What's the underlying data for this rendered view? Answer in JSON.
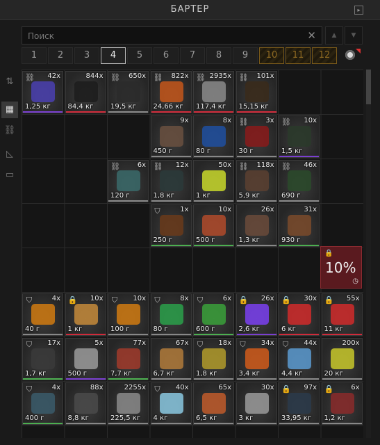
{
  "window": {
    "title": "БАРТЕР"
  },
  "search": {
    "placeholder": "Поиск"
  },
  "pages": [
    "1",
    "2",
    "3",
    "4",
    "5",
    "6",
    "7",
    "8",
    "9",
    "10",
    "11",
    "12"
  ],
  "active_page": "4",
  "locked_percent": "10%",
  "colors": {
    "common": "#888888",
    "uncommon": "#4caf50",
    "rare": "#7a3fd0",
    "epic": "#d02a3a"
  },
  "items": [
    {
      "row": 0,
      "col": 0,
      "qty": "42x",
      "price": "1,25 кг",
      "mark": "link",
      "color": "#4a3fb0",
      "rarity": "#7a3fd0"
    },
    {
      "row": 0,
      "col": 1,
      "qty": "844x",
      "price": "84,4 кг",
      "mark": "",
      "color": "#1c1c1c",
      "rarity": "#d02a3a"
    },
    {
      "row": 0,
      "col": 2,
      "qty": "650x",
      "price": "19,5 кг",
      "mark": "link",
      "color": "#2a2a2a",
      "rarity": "#888888"
    },
    {
      "row": 0,
      "col": 3,
      "qty": "822x",
      "price": "24,66 кг",
      "mark": "link",
      "color": "#c4561a",
      "rarity": "#d02a3a"
    },
    {
      "row": 0,
      "col": 4,
      "qty": "2935x",
      "price": "117,4 кг",
      "mark": "link",
      "color": "#8a8a8a",
      "rarity": "#d02a3a"
    },
    {
      "row": 0,
      "col": 5,
      "qty": "101x",
      "price": "15,15 кг",
      "mark": "link",
      "color": "#3a2a1a",
      "rarity": "#d02a3a"
    },
    {
      "row": 1,
      "col": 3,
      "qty": "9x",
      "price": "450 г",
      "mark": "",
      "color": "#6a5040",
      "rarity": "#888888"
    },
    {
      "row": 1,
      "col": 4,
      "qty": "8x",
      "price": "80 г",
      "mark": "",
      "color": "#1f4fa0",
      "rarity": "#888888"
    },
    {
      "row": 1,
      "col": 5,
      "qty": "3x",
      "price": "30 г",
      "mark": "link",
      "color": "#8a1a1a",
      "rarity": "#888888"
    },
    {
      "row": 1,
      "col": 6,
      "qty": "10x",
      "price": "1,5 кг",
      "mark": "link",
      "color": "#2a3a2a",
      "rarity": "#7a3fd0"
    },
    {
      "row": 2,
      "col": 2,
      "qty": "6x",
      "price": "120 г",
      "mark": "link",
      "color": "#3a6a6a",
      "rarity": "#888888"
    },
    {
      "row": 2,
      "col": 3,
      "qty": "12x",
      "price": "1,8 кг",
      "mark": "link",
      "color": "#2a3a3a",
      "rarity": "#888888"
    },
    {
      "row": 2,
      "col": 4,
      "qty": "50x",
      "price": "1 кг",
      "mark": "",
      "color": "#c8d82a",
      "rarity": "#888888"
    },
    {
      "row": 2,
      "col": 5,
      "qty": "118x",
      "price": "5,9 кг",
      "mark": "link",
      "color": "#5a4030",
      "rarity": "#888888"
    },
    {
      "row": 2,
      "col": 6,
      "qty": "46x",
      "price": "690 г",
      "mark": "link",
      "color": "#2a4a2a",
      "rarity": "#888888"
    },
    {
      "row": 3,
      "col": 3,
      "qty": "1x",
      "price": "250 г",
      "mark": "shield",
      "color": "#6a3a1a",
      "rarity": "#4caf50"
    },
    {
      "row": 3,
      "col": 4,
      "qty": "10x",
      "price": "500 г",
      "mark": "",
      "color": "#b04a2a",
      "rarity": "#4caf50"
    },
    {
      "row": 3,
      "col": 5,
      "qty": "26x",
      "price": "1,3 кг",
      "mark": "",
      "color": "#6a4a3a",
      "rarity": "#888888"
    },
    {
      "row": 3,
      "col": 6,
      "qty": "31x",
      "price": "930 г",
      "mark": "",
      "color": "#7a4a2a",
      "rarity": "#4caf50"
    },
    {
      "row": 5,
      "col": 0,
      "qty": "4x",
      "price": "40 г",
      "mark": "shield",
      "color": "#d07a10",
      "rarity": "#888888"
    },
    {
      "row": 5,
      "col": 1,
      "qty": "10x",
      "price": "1 кг",
      "mark": "lock",
      "color": "#c48a3a",
      "rarity": "#d02a3a"
    },
    {
      "row": 5,
      "col": 2,
      "qty": "10x",
      "price": "100 г",
      "mark": "shield",
      "color": "#d07a10",
      "rarity": "#888888"
    },
    {
      "row": 5,
      "col": 3,
      "qty": "8x",
      "price": "80 г",
      "mark": "shield",
      "color": "#2aa04a",
      "rarity": "#888888"
    },
    {
      "row": 5,
      "col": 4,
      "qty": "6x",
      "price": "600 г",
      "mark": "shield",
      "color": "#3aa03a",
      "rarity": "#4caf50"
    },
    {
      "row": 5,
      "col": 5,
      "qty": "26x",
      "price": "2,6 кг",
      "mark": "lock",
      "color": "#7a3ff0",
      "rarity": "#7a3fd0"
    },
    {
      "row": 5,
      "col": 6,
      "qty": "30x",
      "price": "6 кг",
      "mark": "lock",
      "color": "#d02a2a",
      "rarity": "#d02a3a"
    },
    {
      "row": 5,
      "col": 7,
      "qty": "55x",
      "price": "11 кг",
      "mark": "lock",
      "color": "#d02a2a",
      "rarity": "#d02a3a"
    },
    {
      "row": 6,
      "col": 0,
      "qty": "17x",
      "price": "1,7 кг",
      "mark": "shield",
      "color": "#3a3a3a",
      "rarity": "#4caf50"
    },
    {
      "row": 6,
      "col": 1,
      "qty": "5x",
      "price": "500 г",
      "mark": "",
      "color": "#9a9a9a",
      "rarity": "#7a3fd0"
    },
    {
      "row": 6,
      "col": 2,
      "qty": "77x",
      "price": "7,7 кг",
      "mark": "",
      "color": "#a03a2a",
      "rarity": "#4caf50"
    },
    {
      "row": 6,
      "col": 3,
      "qty": "67x",
      "price": "6,7 кг",
      "mark": "",
      "color": "#b07a3a",
      "rarity": "#888888"
    },
    {
      "row": 6,
      "col": 4,
      "qty": "18x",
      "price": "1,8 кг",
      "mark": "shield",
      "color": "#b09a2a",
      "rarity": "#888888"
    },
    {
      "row": 6,
      "col": 5,
      "qty": "34x",
      "price": "3,4 кг",
      "mark": "shield",
      "color": "#d05a1a",
      "rarity": "#888888"
    },
    {
      "row": 6,
      "col": 6,
      "qty": "44x",
      "price": "4,4 кг",
      "mark": "shield",
      "color": "#5a9ad0",
      "rarity": "#888888"
    },
    {
      "row": 6,
      "col": 7,
      "qty": "200x",
      "price": "20 кг",
      "mark": "",
      "color": "#c8c82a",
      "rarity": "#888888"
    },
    {
      "row": 7,
      "col": 0,
      "qty": "4x",
      "price": "400 г",
      "mark": "shield",
      "color": "#3a5a6a",
      "rarity": "#4caf50"
    },
    {
      "row": 7,
      "col": 1,
      "qty": "88x",
      "price": "8,8 кг",
      "mark": "",
      "color": "#4a4a4a",
      "rarity": "#888888"
    },
    {
      "row": 7,
      "col": 2,
      "qty": "2255x",
      "price": "225,5 кг",
      "mark": "",
      "color": "#8a8a8a",
      "rarity": "#888888"
    },
    {
      "row": 7,
      "col": 3,
      "qty": "40x",
      "price": "4 кг",
      "mark": "shield",
      "color": "#8ac8e0",
      "rarity": "#888888"
    },
    {
      "row": 7,
      "col": 4,
      "qty": "65x",
      "price": "6,5 кг",
      "mark": "",
      "color": "#c05a2a",
      "rarity": "#888888"
    },
    {
      "row": 7,
      "col": 5,
      "qty": "30x",
      "price": "3 кг",
      "mark": "",
      "color": "#9a9a9a",
      "rarity": "#888888"
    },
    {
      "row": 7,
      "col": 6,
      "qty": "97x",
      "price": "33,95 кг",
      "mark": "lock",
      "color": "#2a3a4a",
      "rarity": "#888888"
    },
    {
      "row": 7,
      "col": 7,
      "qty": "6x",
      "price": "1,2 кг",
      "mark": "lock",
      "color": "#8a2a2a",
      "rarity": "#888888"
    }
  ]
}
